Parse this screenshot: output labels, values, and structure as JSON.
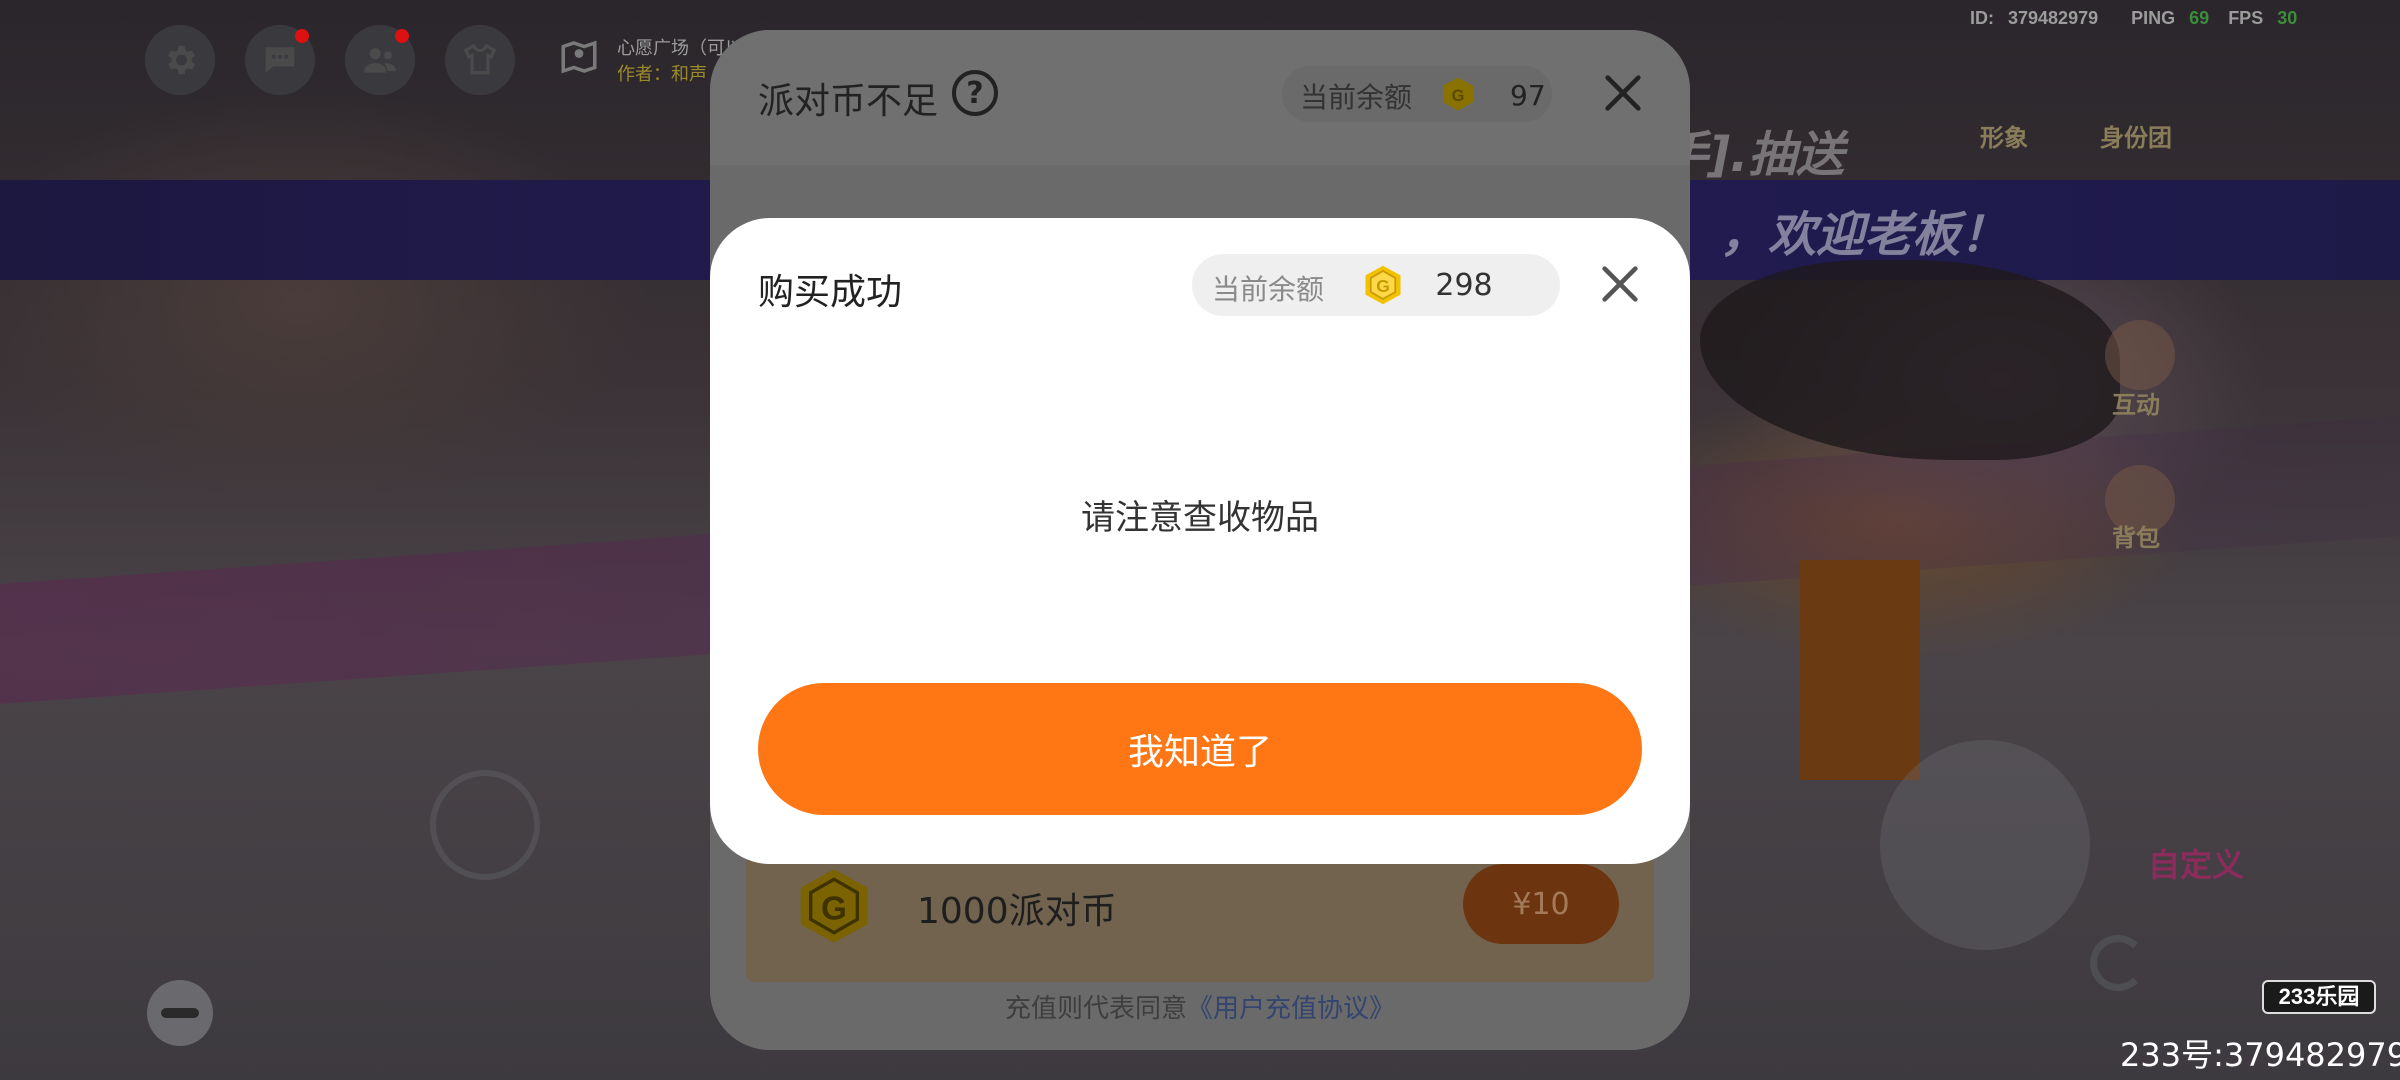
{
  "hud": {
    "location_title": "心愿广场（可以",
    "location_author": "作者：和声",
    "stats": {
      "id_label": "ID:",
      "id": "379482979",
      "ping_label": "PING",
      "ping": "69",
      "fps_label": "FPS",
      "fps": "30"
    },
    "side_buttons": {
      "appearance": "形象",
      "identity": "身份团",
      "interact": "互动",
      "backpack": "背包",
      "custom": "自定义"
    },
    "banner_text": "，欢迎老板！",
    "banner_text_2": "手].抽送"
  },
  "back_dialog": {
    "title": "派对币不足",
    "help_icon": "?",
    "balance_label": "当前余额",
    "balance_value": "97",
    "pack_label": "1000派对币",
    "pack_price": "¥10",
    "agreement_prefix": "充值则代表同意",
    "agreement_link": "《用户充值协议》"
  },
  "dialog": {
    "title": "购买成功",
    "balance_label": "当前余额",
    "balance_value": "298",
    "message": "请注意查收物品",
    "confirm_label": "我知道了"
  },
  "watermark": {
    "badge": "233乐园",
    "text": "233号:379482979"
  },
  "colors": {
    "accent_orange": "#ff7614",
    "coin_gold": "#f2c200",
    "dialog_bg": "#ffffff",
    "overlay": "#6f6e6f"
  },
  "icons": [
    "settings-icon",
    "chat-icon",
    "friends-icon",
    "outfit-icon",
    "location-icon",
    "help-icon",
    "coin-icon",
    "close-icon",
    "minus-icon",
    "reload-icon"
  ]
}
